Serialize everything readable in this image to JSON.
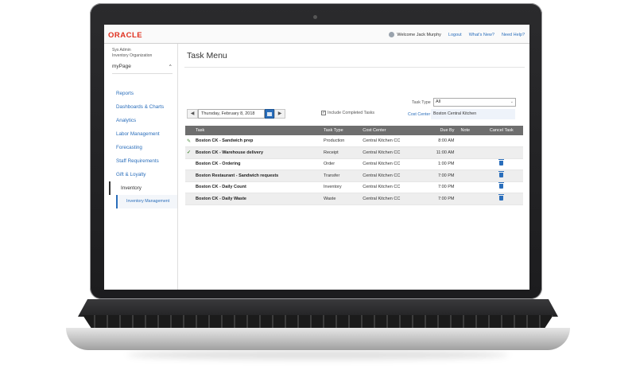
{
  "header": {
    "logo": "ORACLE",
    "welcome": "Welcome Jack Murphy",
    "links": [
      "Logout",
      "What's New?",
      "Need Help?"
    ]
  },
  "sidebar": {
    "user_line1": "Sys Admin",
    "user_line2": "Inventory Organization",
    "mypage": "myPage",
    "items": [
      "Reports",
      "Dashboards & Charts",
      "Analytics",
      "Labor Management",
      "Forecasting",
      "Staff Requirements",
      "Gift & Loyalty",
      "Inventory"
    ],
    "sub_item": "Inventory Management"
  },
  "main": {
    "title": "Task Menu",
    "date": "Thursday, February 8, 2018",
    "include_completed": "Include Completed Tasks",
    "task_type_label": "Task Type",
    "task_type_value": "All",
    "cost_center_label": "Cost Center",
    "cost_center_value": "Boston Central Kitchen"
  },
  "table": {
    "columns": [
      "Task",
      "Task Type",
      "Cost Center",
      "Due By",
      "Note",
      "Cancel Task"
    ],
    "rows": [
      {
        "status": "pencil",
        "task": "Boston CK - Sandwich prep",
        "type": "Production",
        "cost_center": "Central Kitchen CC",
        "due": "8:00 AM",
        "cancel": false
      },
      {
        "status": "check",
        "task": "Boston CK - Warehouse delivery",
        "type": "Receipt",
        "cost_center": "Central Kitchen CC",
        "due": "11:00 AM",
        "cancel": false
      },
      {
        "status": "",
        "task": "Boston CK - Ordering",
        "type": "Order",
        "cost_center": "Central Kitchen CC",
        "due": "1:00 PM",
        "cancel": true
      },
      {
        "status": "",
        "task": "Boston Restaurant - Sandwich requests",
        "type": "Transfer",
        "cost_center": "Central Kitchen CC",
        "due": "7:00 PM",
        "cancel": true
      },
      {
        "status": "",
        "task": "Boston CK - Daily Count",
        "type": "Inventory",
        "cost_center": "Central Kitchen CC",
        "due": "7:00 PM",
        "cancel": true
      },
      {
        "status": "",
        "task": "Boston CK - Daily Waste",
        "type": "Waste",
        "cost_center": "Central Kitchen CC",
        "due": "7:00 PM",
        "cancel": true
      }
    ]
  },
  "colors": {
    "brand": "#e0301e",
    "link": "#2a6ebb",
    "table_header": "#6e6e6e"
  }
}
